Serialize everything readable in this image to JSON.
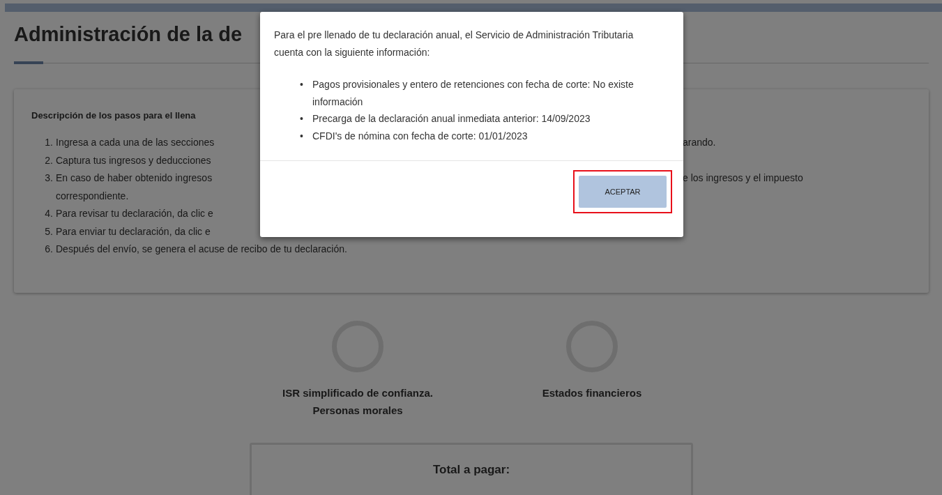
{
  "page": {
    "title": "Administración de la de"
  },
  "steps_card": {
    "heading": "Descripción de los pasos para el llena",
    "steps": [
      {
        "number": "1.",
        "text": "Ingresa a cada una de las secciones",
        "right": "arando."
      },
      {
        "number": "2.",
        "text": "Captura tus ingresos y deducciones"
      },
      {
        "number": "3.",
        "text": "En caso de haber obtenido ingresos",
        "right": "e los ingresos y el impuesto",
        "continued": "correspondiente."
      },
      {
        "number": "4.",
        "text": "Para revisar tu declaración, da clic e"
      },
      {
        "number": "5.",
        "text": "Para enviar tu declaración, da clic e"
      },
      {
        "number": "6.",
        "text": "Después del envío, se genera el acuse de recibo de tu declaración."
      }
    ]
  },
  "sections": [
    {
      "label": "ISR simplificado de confianza. Personas morales"
    },
    {
      "label": "Estados financieros"
    }
  ],
  "total": {
    "label": "Total a pagar:"
  },
  "modal": {
    "intro": "Para el pre llenado de tu declaración anual, el Servicio de Administración Tributaria cuenta con la siguiente información:",
    "items": [
      {
        "bullet": "•",
        "text": "Pagos provisionales y entero de retenciones con fecha de corte: No existe información"
      },
      {
        "bullet": "•",
        "text": "Precarga de la declaración anual inmediata anterior: 14/09/2023"
      },
      {
        "bullet": "•",
        "text": "CFDI's de nómina con fecha de corte: 01/01/2023"
      }
    ],
    "button": {
      "label": "ACEPTAR",
      "highlighted": true
    }
  }
}
